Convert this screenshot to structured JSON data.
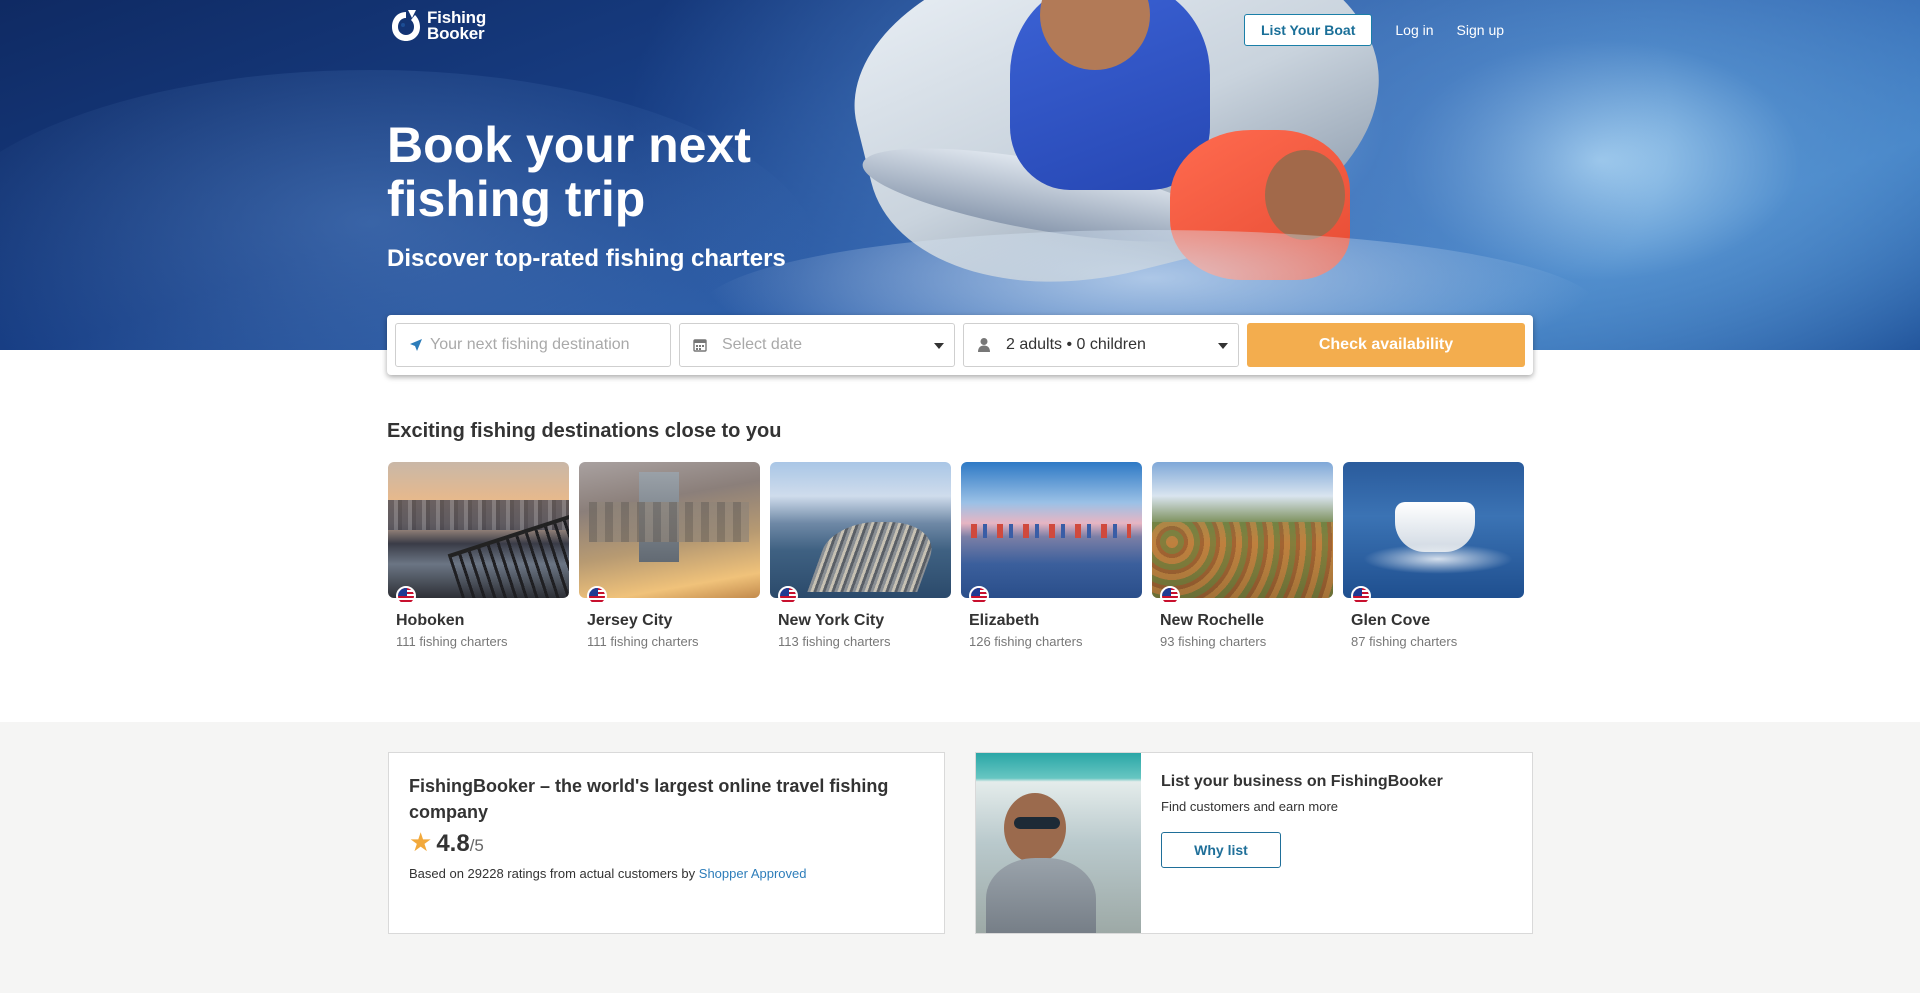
{
  "brand": {
    "line1": "Fishing",
    "line2": "Booker"
  },
  "nav": {
    "list_boat": "List Your Boat",
    "login": "Log in",
    "signup": "Sign up"
  },
  "hero": {
    "title": "Book your next fishing trip",
    "subtitle": "Discover top-rated fishing charters"
  },
  "search": {
    "destination_placeholder": "Your next fishing destination",
    "date_placeholder": "Select date",
    "guests_value": "2 adults • 0 children",
    "check_label": "Check availability"
  },
  "destinations": {
    "title": "Exciting fishing destinations close to you",
    "items": [
      {
        "name": "Hoboken",
        "count": "111 fishing charters"
      },
      {
        "name": "Jersey City",
        "count": "111 fishing charters"
      },
      {
        "name": "New York City",
        "count": "113 fishing charters"
      },
      {
        "name": "Elizabeth",
        "count": "126 fishing charters"
      },
      {
        "name": "New Rochelle",
        "count": "93 fishing charters"
      },
      {
        "name": "Glen Cove",
        "count": "87 fishing charters"
      }
    ]
  },
  "trust": {
    "title": "FishingBooker – the world's largest online travel fishing company",
    "rating": "4.8",
    "rating_max": "/5",
    "note": "Based on 29228 ratings from actual customers by",
    "source": "Shopper Approved"
  },
  "list_business": {
    "title": "List your business on FishingBooker",
    "subtitle": "Find customers and earn more",
    "button": "Why list"
  },
  "colors": {
    "accent_orange": "#f3ad4e",
    "link_blue": "#2d7dba",
    "star": "#f2a93b"
  }
}
